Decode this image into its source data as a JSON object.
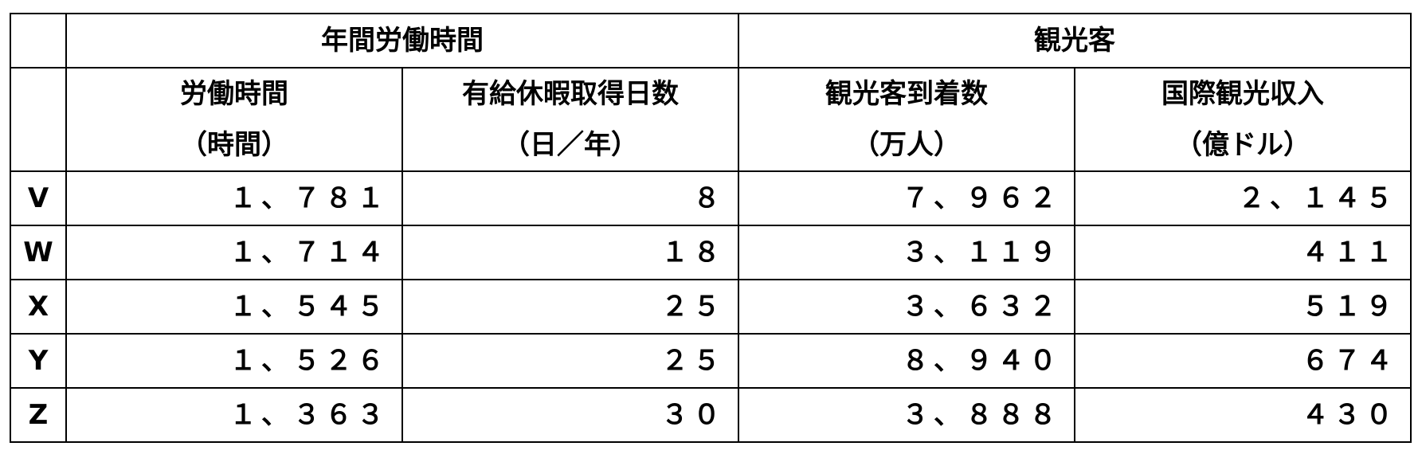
{
  "table": {
    "group_headers": {
      "annual_hours": "年間労働時間",
      "tourists": "観光客"
    },
    "columns": [
      {
        "name": "労働時間",
        "unit": "（時間）"
      },
      {
        "name": "有給休暇取得日数",
        "unit": "（日／年）"
      },
      {
        "name": "観光客到着数",
        "unit": "（万人）"
      },
      {
        "name": "国際観光収入",
        "unit": "（億ドル）"
      }
    ],
    "rows": [
      {
        "label": "V",
        "values": [
          "１、７８１",
          "８",
          "７、９６２",
          "２、１４５"
        ]
      },
      {
        "label": "W",
        "values": [
          "１、７１４",
          "１８",
          "３、１１９",
          "４１１"
        ]
      },
      {
        "label": "X",
        "values": [
          "１、５４５",
          "２５",
          "３、６３２",
          "５１９"
        ]
      },
      {
        "label": "Y",
        "values": [
          "１、５２６",
          "２５",
          "８、９４０",
          "６７４"
        ]
      },
      {
        "label": "Z",
        "values": [
          "１、３６３",
          "３０",
          "３、８８８",
          "４３０"
        ]
      }
    ]
  }
}
